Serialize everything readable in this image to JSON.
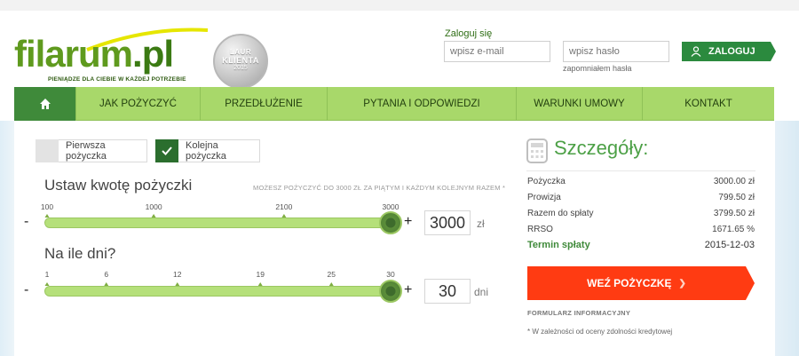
{
  "brand": {
    "name": "filarum",
    "tld": ".pl",
    "tagline": "PIENIĄDZE DLA CIEBIE W KAŻDEJ POTRZEBIE",
    "badge": {
      "line1": "LAUR",
      "line2": "KLIENTA",
      "line3": "2015"
    },
    "colors": {
      "green": "#5f9a1e",
      "darkGreen": "#2b6e2e",
      "orange": "#ff3b12",
      "navGreen": "#a8d86a"
    }
  },
  "login": {
    "title": "Zaloguj się",
    "email_placeholder": "wpisz e-mail",
    "password_placeholder": "wpisz hasło",
    "forgot": "zapomniałem hasła",
    "button": "ZALOGUJ",
    "button_icon": "user-icon"
  },
  "nav": {
    "home_icon": "home-icon",
    "items": [
      "JAK POŻYCZYĆ",
      "PRZEDŁUŻENIE",
      "PYTANIA I ODPOWIEDZI",
      "WARUNKI UMOWY",
      "KONTAKT"
    ]
  },
  "loan_type": {
    "first": "Pierwsza pożyczka",
    "next": "Kolejna pożyczka",
    "selected": "next"
  },
  "amount": {
    "title": "Ustaw kwotę pożyczki",
    "note": "MOŻESZ POŻYCZYĆ DO 3000 ZŁ ZA PIĄTYM I KAŻDYM KOLEJNYM RAZEM *",
    "ticks": [
      "100",
      "1000",
      "2100",
      "3000"
    ],
    "min": 100,
    "max": 3000,
    "value": "3000",
    "unit": "zł",
    "minus": "-",
    "plus": "+"
  },
  "days": {
    "title": "Na ile dni?",
    "ticks": [
      "1",
      "6",
      "12",
      "19",
      "25",
      "30"
    ],
    "min": 1,
    "max": 30,
    "value": "30",
    "unit": "dni",
    "minus": "-",
    "plus": "+"
  },
  "details": {
    "title": "Szczegóły:",
    "icon": "calculator-icon",
    "rows": [
      {
        "label": "Pożyczka",
        "value": "3000.00 zł"
      },
      {
        "label": "Prowizja",
        "value": "799.50 zł"
      },
      {
        "label": "Razem do spłaty",
        "value": "3799.50 zł"
      },
      {
        "label": "RRSO",
        "value": "1671.65 %"
      },
      {
        "label": "Termin spłaty",
        "value": "2015-12-03"
      }
    ],
    "apply_button": "WEŹ POŻYCZKĘ",
    "form_info": "FORMULARZ INFORMACYJNY",
    "footnote": "* W zależności od oceny zdolności kredytowej"
  }
}
